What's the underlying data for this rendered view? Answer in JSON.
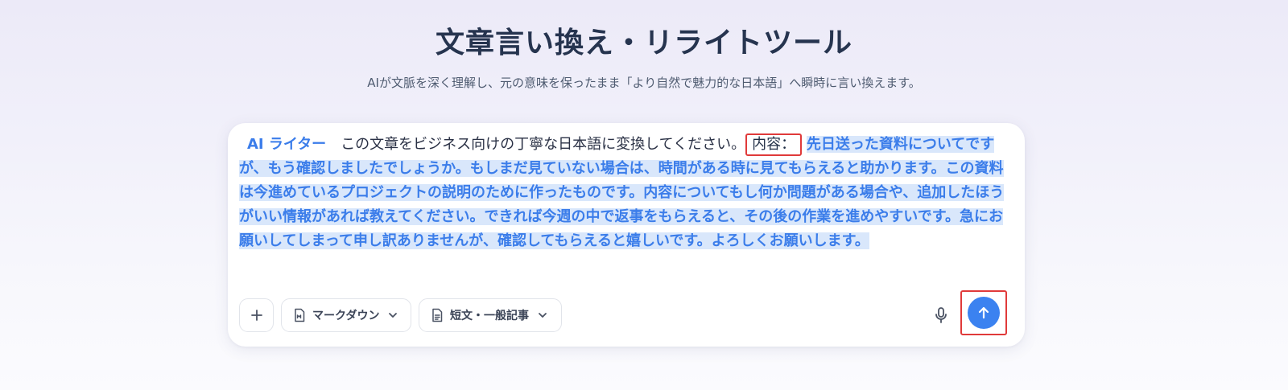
{
  "header": {
    "title": "文章言い換え・リライトツール",
    "subtitle": "AIが文脈を深く理解し、元の意味を保ったまま「より自然で魅力的な日本語」へ瞬時に言い換えます。"
  },
  "editor": {
    "chip_label": "AI ライター",
    "command_text": "この文章をビジネス向けの丁寧な日本語に変換してください。",
    "content_key": "内容：",
    "content_text": "先日送った資料についてですが、もう確認しましたでしょうか。もしまだ見ていない場合は、時間がある時に見てもらえると助かります。この資料は今進めているプロジェクトの説明のために作ったものです。内容についてもし何か問題がある場合や、追加したほうがいい情報があれば教えてください。できれば今週の中で返事をもらえると、その後の作業を進めやすいです。急にお願いしてしまって申し訳ありませんが、確認してもらえると嬉しいです。よろしくお願いします。"
  },
  "toolbar": {
    "add_icon": "plus-icon",
    "format_label": "マークダウン",
    "format_icon": "markdown-file-icon",
    "length_label": "短文・一般記事",
    "length_icon": "document-icon",
    "mic_icon": "microphone-icon",
    "send_icon": "arrow-up-icon"
  },
  "colors": {
    "accent": "#3b82f0",
    "highlight_bg": "#d9e7fb",
    "highlight_text": "#3b7dea",
    "annotation_red": "#e03a3a"
  }
}
